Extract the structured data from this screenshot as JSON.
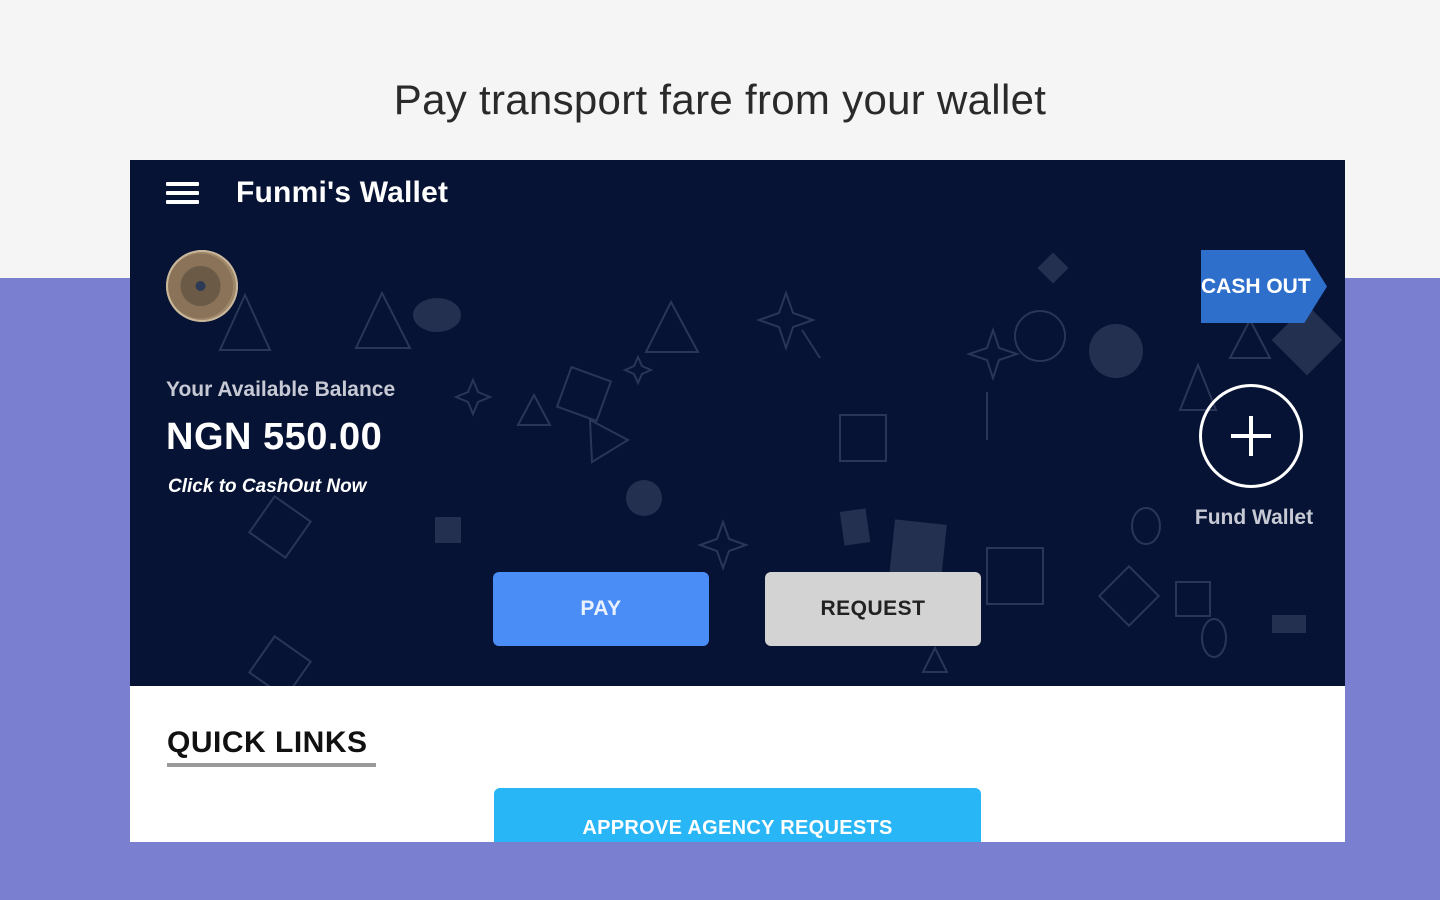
{
  "banner": {
    "headline": "Pay transport fare from your wallet"
  },
  "app": {
    "title": "Funmi's Wallet",
    "balance_label": "Your Available Balance",
    "balance_amount": "NGN 550.00",
    "cashout_link": "Click to CashOut Now",
    "cashout_button": "CASH OUT",
    "fund_wallet_label": "Fund Wallet",
    "pay_button": "PAY",
    "request_button": "REQUEST"
  },
  "quick_links": {
    "title": "QUICK LINKS",
    "approve_button": "APPROVE AGENCY REQUESTS"
  },
  "colors": {
    "hero_background": "#061334",
    "page_background": "#7b7fd0",
    "pay_button": "#4b8df6",
    "request_button": "#d3d3d3",
    "cashout_button": "#2f6fcc",
    "approve_button": "#29b6f6"
  },
  "icons": {
    "menu": "hamburger-menu-icon",
    "fund": "plus-icon"
  }
}
